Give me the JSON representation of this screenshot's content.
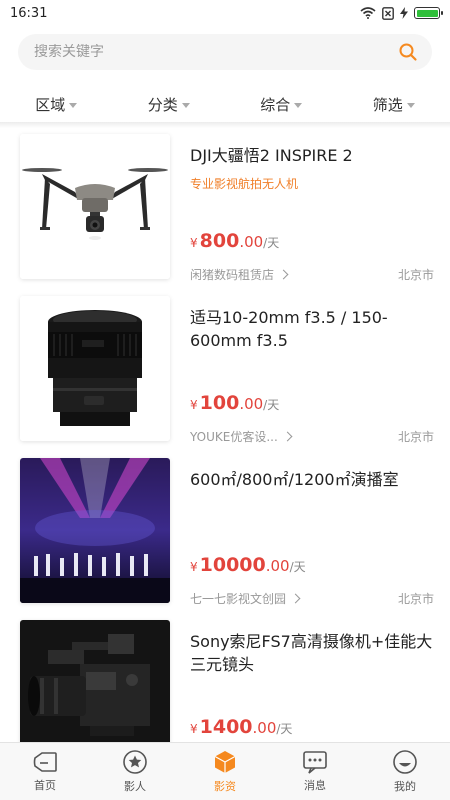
{
  "status": {
    "time": "16:31"
  },
  "search": {
    "placeholder": "搜索关键字"
  },
  "filters": [
    {
      "label": "区域"
    },
    {
      "label": "分类"
    },
    {
      "label": "综合"
    },
    {
      "label": "筛选"
    }
  ],
  "listings": [
    {
      "title": "DJI大疆悟2 INSPIRE 2",
      "subtitle": "专业影视航拍无人机",
      "currency": "¥",
      "price_int": "800",
      "price_dec": ".00",
      "unit": "/天",
      "shop": "闲猪数码租赁店",
      "city": "北京市"
    },
    {
      "title": "适马10-20mm f3.5 / 150-600mm f3.5",
      "subtitle": "",
      "currency": "¥",
      "price_int": "100",
      "price_dec": ".00",
      "unit": "/天",
      "shop": "YOUKE优客设...",
      "city": "北京市"
    },
    {
      "title": "600㎡/800㎡/1200㎡演播室",
      "subtitle": "",
      "currency": "¥",
      "price_int": "10000",
      "price_dec": ".00",
      "unit": "/天",
      "shop": "七一七影视文创园",
      "city": "北京市"
    },
    {
      "title": "Sony索尼FS7高清摄像机+佳能大三元镜头",
      "subtitle": "",
      "currency": "¥",
      "price_int": "1400",
      "price_dec": ".00",
      "unit": "/天",
      "shop": "",
      "city": ""
    }
  ],
  "tabs": [
    {
      "label": "首页",
      "icon": "tag-icon"
    },
    {
      "label": "影人",
      "icon": "star-icon"
    },
    {
      "label": "影资",
      "icon": "box-icon",
      "active": true
    },
    {
      "label": "消息",
      "icon": "message-icon"
    },
    {
      "label": "我的",
      "icon": "smile-icon"
    }
  ],
  "colors": {
    "accent": "#f5891f",
    "price": "#e2443c",
    "subtitle": "#f07f29"
  }
}
